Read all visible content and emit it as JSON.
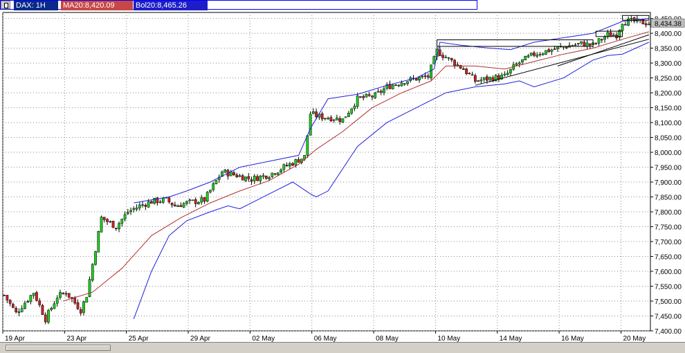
{
  "toolbar": {
    "symbol_label": "DAX: 1H",
    "ma_label": "MA20:8,420.09",
    "bol_label": "Bol20:8,465.26"
  },
  "colors": {
    "bull_candle": "#22cc22",
    "bear_candle": "#cc2222",
    "ma_line": "#b03030",
    "bollinger": "#1e1ee0",
    "trendline": "#000000",
    "grid": "#888888",
    "last_price_box": "#c0c0c0"
  },
  "chart_data": {
    "type": "candlestick",
    "symbol": "DAX",
    "timeframe": "1H",
    "ylim": [
      7400,
      8470
    ],
    "y_ticks": [
      7400,
      7450,
      7500,
      7550,
      7600,
      7650,
      7700,
      7750,
      7800,
      7850,
      7900,
      7950,
      8000,
      8050,
      8100,
      8150,
      8200,
      8250,
      8300,
      8350,
      8400,
      8450
    ],
    "y_tick_labels": [
      "7,400.00",
      "7,450.00",
      "7,500.00",
      "7,550.00",
      "7,600.00",
      "7,650.00",
      "7,700.00",
      "7,750.00",
      "7,800.00",
      "7,850.00",
      "7,900.00",
      "7,950.00",
      "8,000.00",
      "8,050.00",
      "8,100.00",
      "8,150.00",
      "8,200.00",
      "8,250.00",
      "8,300.00",
      "8,350.00",
      "8,400.00",
      "8,450.00"
    ],
    "x_labels": [
      "19 Apr",
      "23 Apr",
      "25 Apr",
      "29 Apr",
      "02 May",
      "06 May",
      "08 May",
      "10 May",
      "14 May",
      "16 May",
      "20 May"
    ],
    "bar_count": 220,
    "label_bars": [
      0,
      21,
      42,
      63,
      84,
      105,
      126,
      147,
      168,
      189,
      210
    ],
    "last_price": 8434.38,
    "last_price_label": "8,434.38",
    "grid": true,
    "price_path": [
      [
        0,
        7520
      ],
      [
        4,
        7460
      ],
      [
        10,
        7530
      ],
      [
        14,
        7440
      ],
      [
        18,
        7515
      ],
      [
        21,
        7530
      ],
      [
        26,
        7470
      ],
      [
        28,
        7520
      ],
      [
        33,
        7780
      ],
      [
        38,
        7750
      ],
      [
        42,
        7800
      ],
      [
        46,
        7820
      ],
      [
        50,
        7835
      ],
      [
        55,
        7840
      ],
      [
        58,
        7820
      ],
      [
        62,
        7830
      ],
      [
        68,
        7840
      ],
      [
        74,
        7935
      ],
      [
        80,
        7920
      ],
      [
        84,
        7910
      ],
      [
        90,
        7925
      ],
      [
        96,
        7955
      ],
      [
        102,
        7985
      ],
      [
        104,
        8130
      ],
      [
        107,
        8120
      ],
      [
        112,
        8115
      ],
      [
        115,
        8110
      ],
      [
        120,
        8180
      ],
      [
        126,
        8190
      ],
      [
        130,
        8220
      ],
      [
        136,
        8240
      ],
      [
        144,
        8255
      ],
      [
        147,
        8340
      ],
      [
        150,
        8320
      ],
      [
        156,
        8280
      ],
      [
        160,
        8240
      ],
      [
        166,
        8250
      ],
      [
        170,
        8255
      ],
      [
        174,
        8295
      ],
      [
        180,
        8330
      ],
      [
        186,
        8345
      ],
      [
        190,
        8355
      ],
      [
        196,
        8365
      ],
      [
        200,
        8360
      ],
      [
        205,
        8395
      ],
      [
        208,
        8395
      ],
      [
        210,
        8440
      ],
      [
        214,
        8440
      ],
      [
        219,
        8434
      ]
    ],
    "series": [
      {
        "name": "MA20",
        "values": [
          [
            20,
            7500
          ],
          [
            30,
            7530
          ],
          [
            40,
            7610
          ],
          [
            50,
            7720
          ],
          [
            60,
            7780
          ],
          [
            70,
            7830
          ],
          [
            80,
            7870
          ],
          [
            90,
            7905
          ],
          [
            100,
            7960
          ],
          [
            106,
            8010
          ],
          [
            115,
            8070
          ],
          [
            125,
            8150
          ],
          [
            135,
            8200
          ],
          [
            145,
            8240
          ],
          [
            150,
            8290
          ],
          [
            160,
            8290
          ],
          [
            170,
            8280
          ],
          [
            180,
            8305
          ],
          [
            190,
            8330
          ],
          [
            200,
            8350
          ],
          [
            210,
            8380
          ],
          [
            219,
            8405
          ]
        ]
      },
      {
        "name": "Bol20 upper",
        "values": [
          [
            44,
            7830
          ],
          [
            50,
            7840
          ],
          [
            56,
            7850
          ],
          [
            62,
            7870
          ],
          [
            70,
            7900
          ],
          [
            80,
            7950
          ],
          [
            90,
            7970
          ],
          [
            100,
            7990
          ],
          [
            104,
            8080
          ],
          [
            110,
            8180
          ],
          [
            120,
            8195
          ],
          [
            130,
            8225
          ],
          [
            140,
            8250
          ],
          [
            146,
            8280
          ],
          [
            148,
            8370
          ],
          [
            155,
            8360
          ],
          [
            165,
            8350
          ],
          [
            172,
            8345
          ],
          [
            180,
            8370
          ],
          [
            190,
            8385
          ],
          [
            200,
            8400
          ],
          [
            210,
            8440
          ],
          [
            219,
            8450
          ]
        ]
      },
      {
        "name": "Bol20 lower",
        "values": [
          [
            44,
            7440
          ],
          [
            50,
            7600
          ],
          [
            56,
            7720
          ],
          [
            62,
            7770
          ],
          [
            70,
            7800
          ],
          [
            76,
            7820
          ],
          [
            80,
            7810
          ],
          [
            86,
            7840
          ],
          [
            92,
            7870
          ],
          [
            98,
            7900
          ],
          [
            104,
            7860
          ],
          [
            106,
            7850
          ],
          [
            110,
            7870
          ],
          [
            120,
            8020
          ],
          [
            130,
            8100
          ],
          [
            140,
            8150
          ],
          [
            146,
            8180
          ],
          [
            150,
            8200
          ],
          [
            160,
            8220
          ],
          [
            170,
            8230
          ],
          [
            175,
            8240
          ],
          [
            180,
            8220
          ],
          [
            190,
            8250
          ],
          [
            200,
            8310
          ],
          [
            205,
            8325
          ],
          [
            210,
            8330
          ],
          [
            219,
            8370
          ]
        ]
      }
    ],
    "annotations": [
      {
        "type": "line",
        "from": [
          160,
          8225
        ],
        "to": [
          219,
          8380
        ]
      },
      {
        "type": "line",
        "from": [
          188,
          8290
        ],
        "to": [
          219,
          8395
        ]
      },
      {
        "type": "box",
        "from": [
          147,
          8356
        ],
        "to": [
          200,
          8378
        ]
      },
      {
        "type": "box",
        "from": [
          201,
          8389
        ],
        "to": [
          210,
          8407
        ]
      },
      {
        "type": "box",
        "from": [
          210,
          8444
        ],
        "to": [
          219,
          8460
        ]
      }
    ]
  }
}
